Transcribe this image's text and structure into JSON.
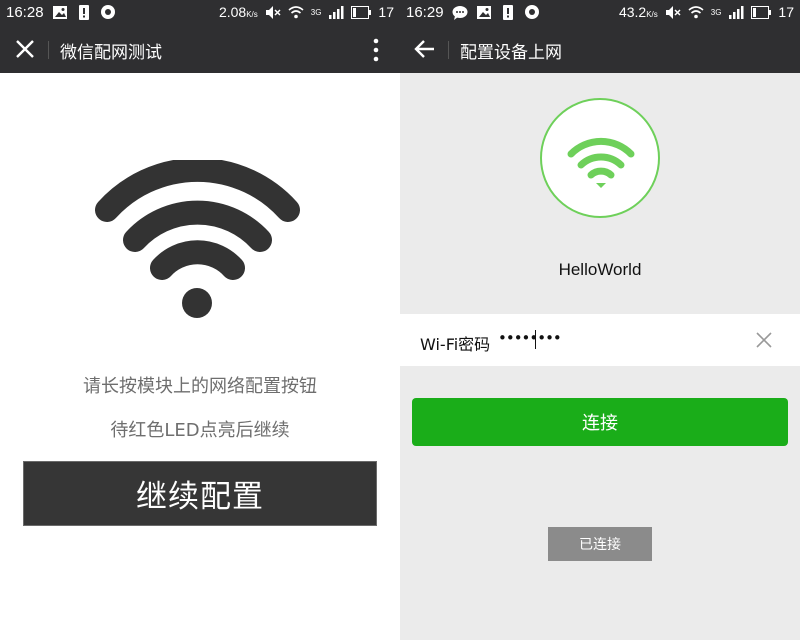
{
  "left_screen": {
    "status_bar": {
      "time": "16:28",
      "net_speed": "2.08",
      "speed_unit": "K/s",
      "network": "3G",
      "battery": "17"
    },
    "app_bar": {
      "title": "微信配网测试",
      "nav_icon": "close-icon",
      "menu_icon": "more-vertical-icon"
    },
    "instructions": [
      "请长按模块上的网络配置按钮",
      "待红色LED点亮后继续"
    ],
    "continue_button": "继续配置",
    "colors": {
      "bar": "#2f2f31",
      "button": "#363636",
      "wifi_icon": "#333333",
      "text": "#6e6e6e"
    }
  },
  "right_screen": {
    "status_bar": {
      "time": "16:29",
      "net_speed": "43.2",
      "speed_unit": "K/s",
      "network": "3G",
      "battery": "17"
    },
    "app_bar": {
      "title": "配置设备上网",
      "nav_icon": "back-arrow-icon"
    },
    "ssid": "HelloWorld",
    "password_field": {
      "label": "Wi-Fi密码",
      "value": "••••••••"
    },
    "connect_button": "连接",
    "connected_badge": "已连接",
    "colors": {
      "accent": "#1aad19",
      "wifi_icon": "#6ed05a",
      "background": "#ebebeb",
      "badge": "#8b8b8b"
    }
  }
}
